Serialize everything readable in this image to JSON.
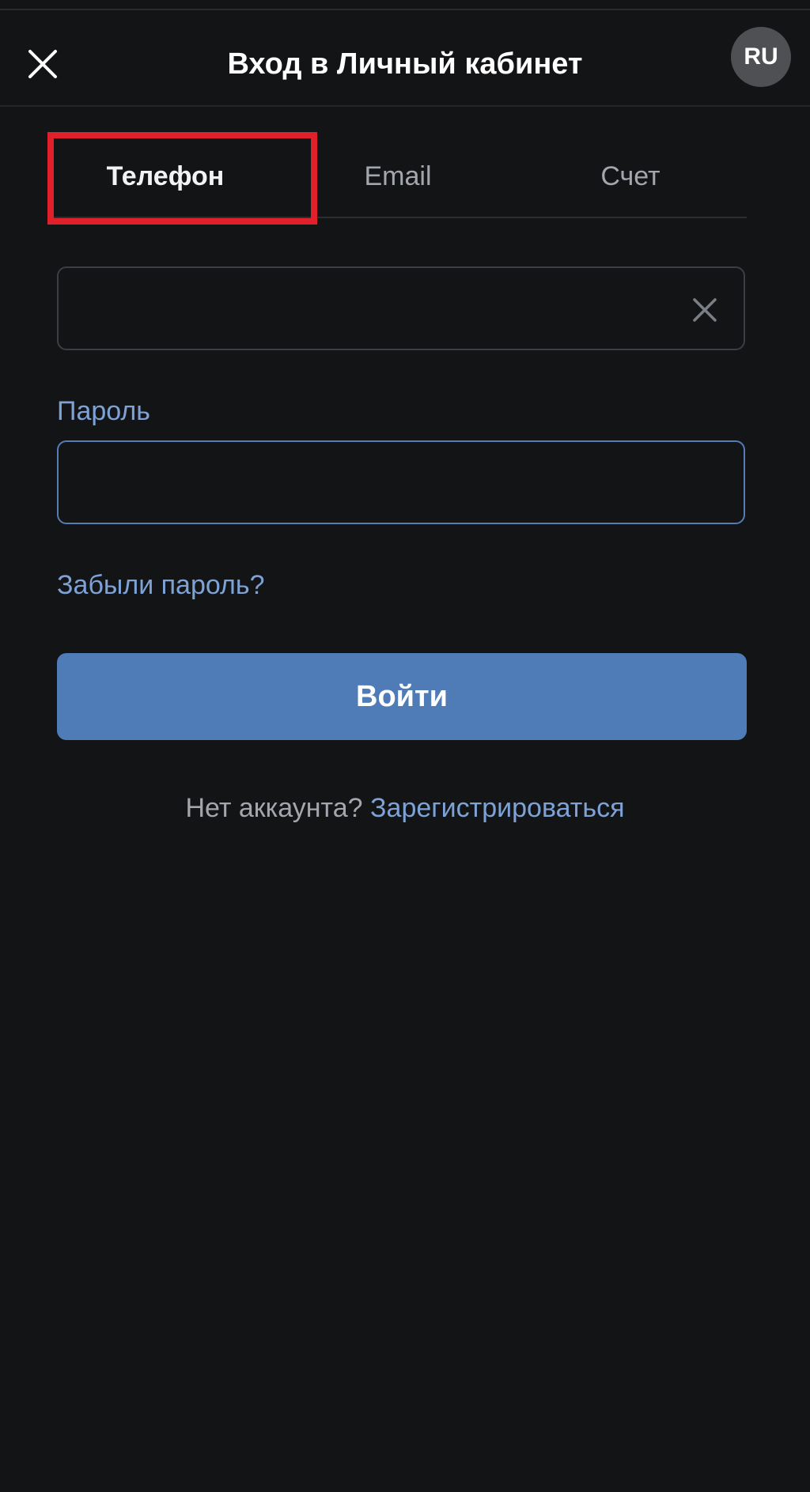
{
  "header": {
    "title": "Вход в Личный кабинет",
    "language": "RU",
    "close_icon": "close-icon"
  },
  "tabs": [
    {
      "label": "Телефон",
      "active": true
    },
    {
      "label": "Email",
      "active": false
    },
    {
      "label": "Счет",
      "active": false
    }
  ],
  "highlight": {
    "color": "#e0202a",
    "target": "Телефон"
  },
  "phone_field": {
    "value": "",
    "placeholder": "",
    "clear_icon": "clear-icon"
  },
  "password": {
    "label": "Пароль",
    "value": "",
    "placeholder": ""
  },
  "forgot_password": "Забыли пароль?",
  "login_button": "Войти",
  "signup": {
    "question": "Нет аккаунта?",
    "link": "Зарегистрироваться"
  },
  "colors": {
    "background": "#131416",
    "accent": "#4f7cb6",
    "link": "#7ea2d6",
    "text": "#ffffff",
    "muted": "#a3a6ac"
  }
}
